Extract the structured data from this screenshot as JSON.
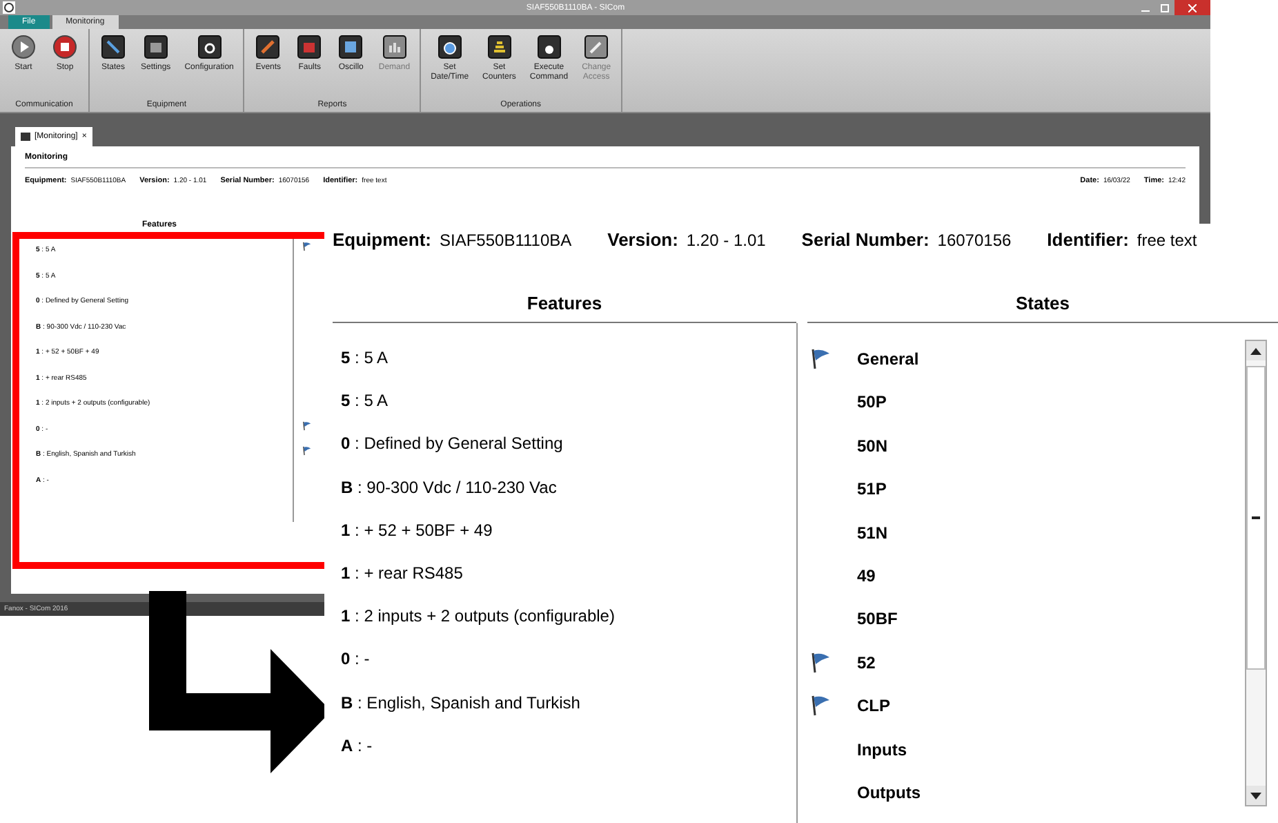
{
  "window": {
    "title": "SIAF550B1110BA - SICom"
  },
  "ribbon_tabs": [
    {
      "label": "File",
      "selected": false,
      "kind": "file"
    },
    {
      "label": "Monitoring",
      "selected": true,
      "kind": "tab"
    }
  ],
  "ribbon_groups": [
    {
      "label": "Communication",
      "buttons": [
        {
          "label": "Start",
          "disabled": false
        },
        {
          "label": "Stop",
          "disabled": false
        }
      ]
    },
    {
      "label": "Equipment",
      "buttons": [
        {
          "label": "States",
          "disabled": false
        },
        {
          "label": "Settings",
          "disabled": false
        },
        {
          "label": "Configuration",
          "disabled": false
        }
      ]
    },
    {
      "label": "Reports",
      "buttons": [
        {
          "label": "Events",
          "disabled": false
        },
        {
          "label": "Faults",
          "disabled": false
        },
        {
          "label": "Oscillo",
          "disabled": false
        },
        {
          "label": "Demand",
          "disabled": true
        }
      ]
    },
    {
      "label": "Operations",
      "buttons": [
        {
          "label": "Set\nDate/Time",
          "disabled": false
        },
        {
          "label": "Set\nCounters",
          "disabled": false
        },
        {
          "label": "Execute\nCommand",
          "disabled": false
        },
        {
          "label": "Change\nAccess",
          "disabled": true
        }
      ]
    }
  ],
  "document_tab": {
    "label": "[Monitoring]",
    "close": "×"
  },
  "panel_title": "Monitoring",
  "info": [
    {
      "label": "Equipment:",
      "value": "SIAF550B1110BA"
    },
    {
      "label": "Version:",
      "value": "1.20 - 1.01"
    },
    {
      "label": "Serial Number:",
      "value": "16070156"
    },
    {
      "label": "Identifier:",
      "value": "free text"
    }
  ],
  "date": {
    "label": "Date:",
    "value": "16/03/22"
  },
  "time": {
    "label": "Time:",
    "value": "12:42"
  },
  "features_heading": "Features",
  "features": [
    {
      "code": "5",
      "text": ": 5 A"
    },
    {
      "code": "5",
      "text": ": 5 A"
    },
    {
      "code": "0",
      "text": ": Defined by General Setting"
    },
    {
      "code": "B",
      "text": ": 90-300 Vdc / 110-230 Vac"
    },
    {
      "code": "1",
      "text": ": + 52 + 50BF + 49"
    },
    {
      "code": "1",
      "text": ": + rear RS485"
    },
    {
      "code": "1",
      "text": ":  2 inputs + 2 outputs (configurable)"
    },
    {
      "code": "0",
      "text": ": -"
    },
    {
      "code": "B",
      "text": ": English, Spanish and Turkish"
    },
    {
      "code": "A",
      "text": ": -"
    }
  ],
  "state_flags": [
    {
      "flag": true
    },
    {
      "flag": false
    },
    {
      "flag": false
    },
    {
      "flag": false
    },
    {
      "flag": false
    },
    {
      "flag": false
    },
    {
      "flag": false
    },
    {
      "flag": true
    },
    {
      "flag": true
    },
    {
      "flag": false
    }
  ],
  "status_bar": "Fanox - SICom 2016",
  "zoom_inset": {
    "info": [
      {
        "label": "Equipment:",
        "value": "SIAF550B1110BA"
      },
      {
        "label": "Version:",
        "value": "1.20 - 1.01"
      },
      {
        "label": "Serial Number:",
        "value": "16070156"
      },
      {
        "label": "Identifier:",
        "value": "free text"
      }
    ],
    "features_heading": "Features",
    "states_heading": "States",
    "features": [
      {
        "code": "5",
        "text": ": 5 A"
      },
      {
        "code": "5",
        "text": ": 5 A"
      },
      {
        "code": "0",
        "text": ": Defined by General Setting"
      },
      {
        "code": "B",
        "text": ": 90-300 Vdc / 110-230 Vac"
      },
      {
        "code": "1",
        "text": ": + 52 + 50BF + 49"
      },
      {
        "code": "1",
        "text": ": + rear RS485"
      },
      {
        "code": "1",
        "text": ":  2 inputs + 2 outputs (configurable)"
      },
      {
        "code": "0",
        "text": ": -"
      },
      {
        "code": "B",
        "text": ": English, Spanish and Turkish"
      },
      {
        "code": "A",
        "text": ": -"
      }
    ],
    "states": [
      {
        "label": "General",
        "flag": true
      },
      {
        "label": "50P",
        "flag": false
      },
      {
        "label": "50N",
        "flag": false
      },
      {
        "label": "51P",
        "flag": false
      },
      {
        "label": "51N",
        "flag": false
      },
      {
        "label": "49",
        "flag": false
      },
      {
        "label": "50BF",
        "flag": false
      },
      {
        "label": "52",
        "flag": true
      },
      {
        "label": "CLP",
        "flag": true
      },
      {
        "label": "Inputs",
        "flag": false
      },
      {
        "label": "Outputs",
        "flag": false
      }
    ]
  }
}
